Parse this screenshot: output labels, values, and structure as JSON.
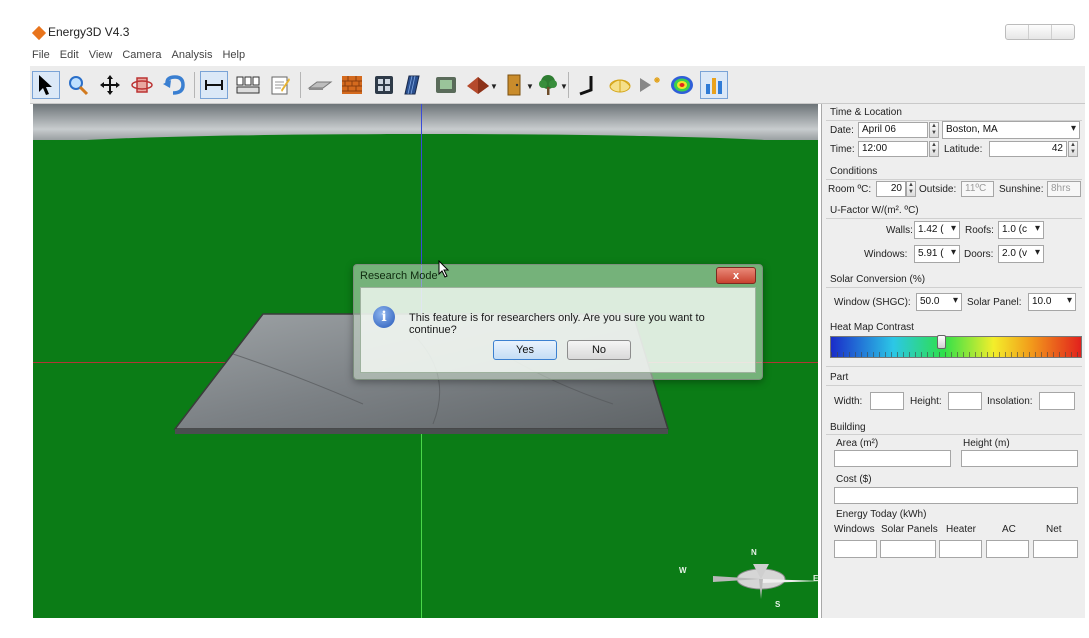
{
  "window": {
    "title": "Energy3D V4.3"
  },
  "menu": [
    "File",
    "Edit",
    "View",
    "Camera",
    "Analysis",
    "Help"
  ],
  "toolbar_icons": [
    "select-arrow",
    "zoom-magnifier",
    "move-cross",
    "rotate-view",
    "undo-arrow",
    "dimension-ruler",
    "print-bench",
    "note-pad",
    "foundation-slab",
    "brick-wall",
    "window-grid",
    "solar-panel",
    "sensor-box",
    "roof-pyramid",
    "door",
    "tree",
    "sun-path",
    "heliodon",
    "sun-ray",
    "heat-map",
    "energy-graph"
  ],
  "dialog": {
    "title": "Research Mode",
    "close_label": "x",
    "message": "This feature is for researchers only. Are you sure you want to continue?",
    "yes_label": "Yes",
    "no_label": "No"
  },
  "compass": {
    "n": "N",
    "s": "S",
    "e": "E",
    "w": "W"
  },
  "panel": {
    "time_location": {
      "title": "Time & Location",
      "date_label": "Date:",
      "date_value": "April 06",
      "location_value": "Boston, MA",
      "time_label": "Time:",
      "time_value": "12:00",
      "latitude_label": "Latitude:",
      "latitude_value": "42"
    },
    "conditions": {
      "title": "Conditions",
      "room_label": "Room ºC:",
      "room_value": "20",
      "outside_label": "Outside:",
      "outside_value": "11ºC",
      "sunshine_label": "Sunshine:",
      "sunshine_value": "8hrs"
    },
    "ufactor": {
      "title": "U-Factor W/(m². ºC)",
      "walls_label": "Walls:",
      "walls_value": "1.42 (",
      "roofs_label": "Roofs:",
      "roofs_value": "1.0 (c",
      "windows_label": "Windows:",
      "windows_value": "5.91 (",
      "doors_label": "Doors:",
      "doors_value": "2.0 (v"
    },
    "solar": {
      "title": "Solar Conversion (%)",
      "window_label": "Window (SHGC):",
      "window_value": "50.0",
      "panel_label": "Solar Panel:",
      "panel_value": "10.0"
    },
    "heatmap": {
      "title": "Heat Map Contrast",
      "level": 0.44
    },
    "part": {
      "title": "Part",
      "width_label": "Width:",
      "height_label": "Height:",
      "insolation_label": "Insolation:"
    },
    "building": {
      "title": "Building",
      "area_label": "Area (m²)",
      "height_label": "Height (m)",
      "cost_label": "Cost ($)"
    },
    "energy": {
      "title": "Energy Today (kWh)",
      "cols": [
        "Windows",
        "Solar Panels",
        "Heater",
        "AC",
        "Net"
      ]
    }
  }
}
